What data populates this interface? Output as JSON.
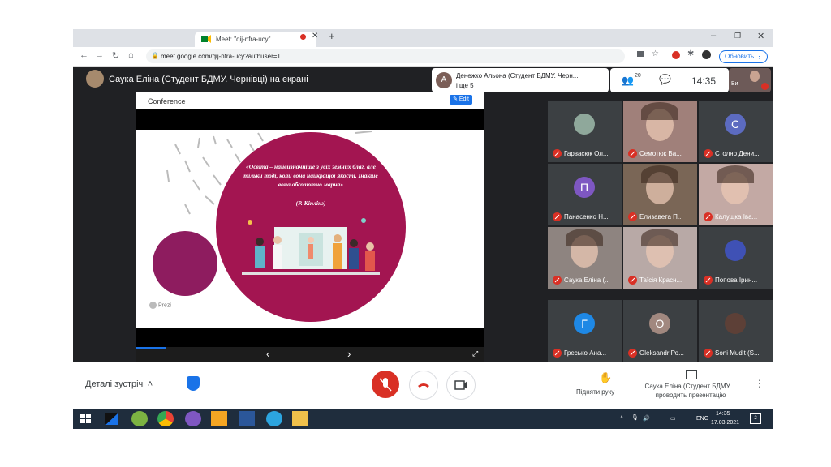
{
  "browser": {
    "tab_title": "Meet: \"qij-nfra-ucy\"",
    "url": "meet.google.com/qij-nfra-ucy?authuser=1",
    "update_label": "Обновить"
  },
  "meet": {
    "presenter_title": "Саука Еліна (Студент БДМУ. Чернівці) на екрані",
    "speaker_name": "Денежко Альона (Студент БДМУ. Черн...",
    "speaker_more": "і ще 5",
    "participant_count": "20",
    "time": "14:35",
    "self_label": "Ви",
    "slide": {
      "header": "Conference",
      "edit_label": "Edit",
      "quote": "«Освіта – найвизначніше з усіх земних благ, але тільки тоді, коли вона найкращої якості. Інакше вона абсолютно марна»",
      "author": "(Р. Кіплінг)",
      "prezi_label": "Prezi",
      "prev": "‹",
      "next": "›"
    },
    "participants": [
      {
        "name": "Гарвасюк Ол...",
        "type": "photo",
        "color": "#8fa89b"
      },
      {
        "name": "Семотюк Ва...",
        "type": "video",
        "color": "#a0807a"
      },
      {
        "name": "Столяр Дени...",
        "type": "letter",
        "letter": "С",
        "color": "#5c6bc0"
      },
      {
        "name": "Панасенко Н...",
        "type": "letter",
        "letter": "П",
        "color": "#7e57c2"
      },
      {
        "name": "Елизавета П...",
        "type": "video",
        "color": "#7a6656"
      },
      {
        "name": "Калущка Іва...",
        "type": "video",
        "color": "#c3a9a4"
      },
      {
        "name": "Саука Еліна (...",
        "type": "video",
        "color": "#8e8480"
      },
      {
        "name": "Таїсія Красн...",
        "type": "video",
        "color": "#b8a9a6"
      },
      {
        "name": "Попова Ірин...",
        "type": "photo",
        "color": "#3f51b5"
      },
      {
        "name": "Гресько Ана...",
        "type": "letter",
        "letter": "Г",
        "color": "#1e88e5"
      },
      {
        "name": "Oleksandr Ро...",
        "type": "letter",
        "letter": "O",
        "color": "#a1887f"
      },
      {
        "name": "Soni Mudit (S...",
        "type": "photo",
        "color": "#5d4037"
      }
    ],
    "bottom": {
      "details_label": "Деталі зустрічі",
      "raise_hand": "Підняти руку",
      "presenting_line1": "Саука Еліна (Студент БДМУ....",
      "presenting_line2": "проводить презентацію"
    }
  },
  "taskbar": {
    "lang": "ENG",
    "clock_time": "14:35",
    "clock_date": "17.03.2021",
    "notif_count": "2"
  }
}
